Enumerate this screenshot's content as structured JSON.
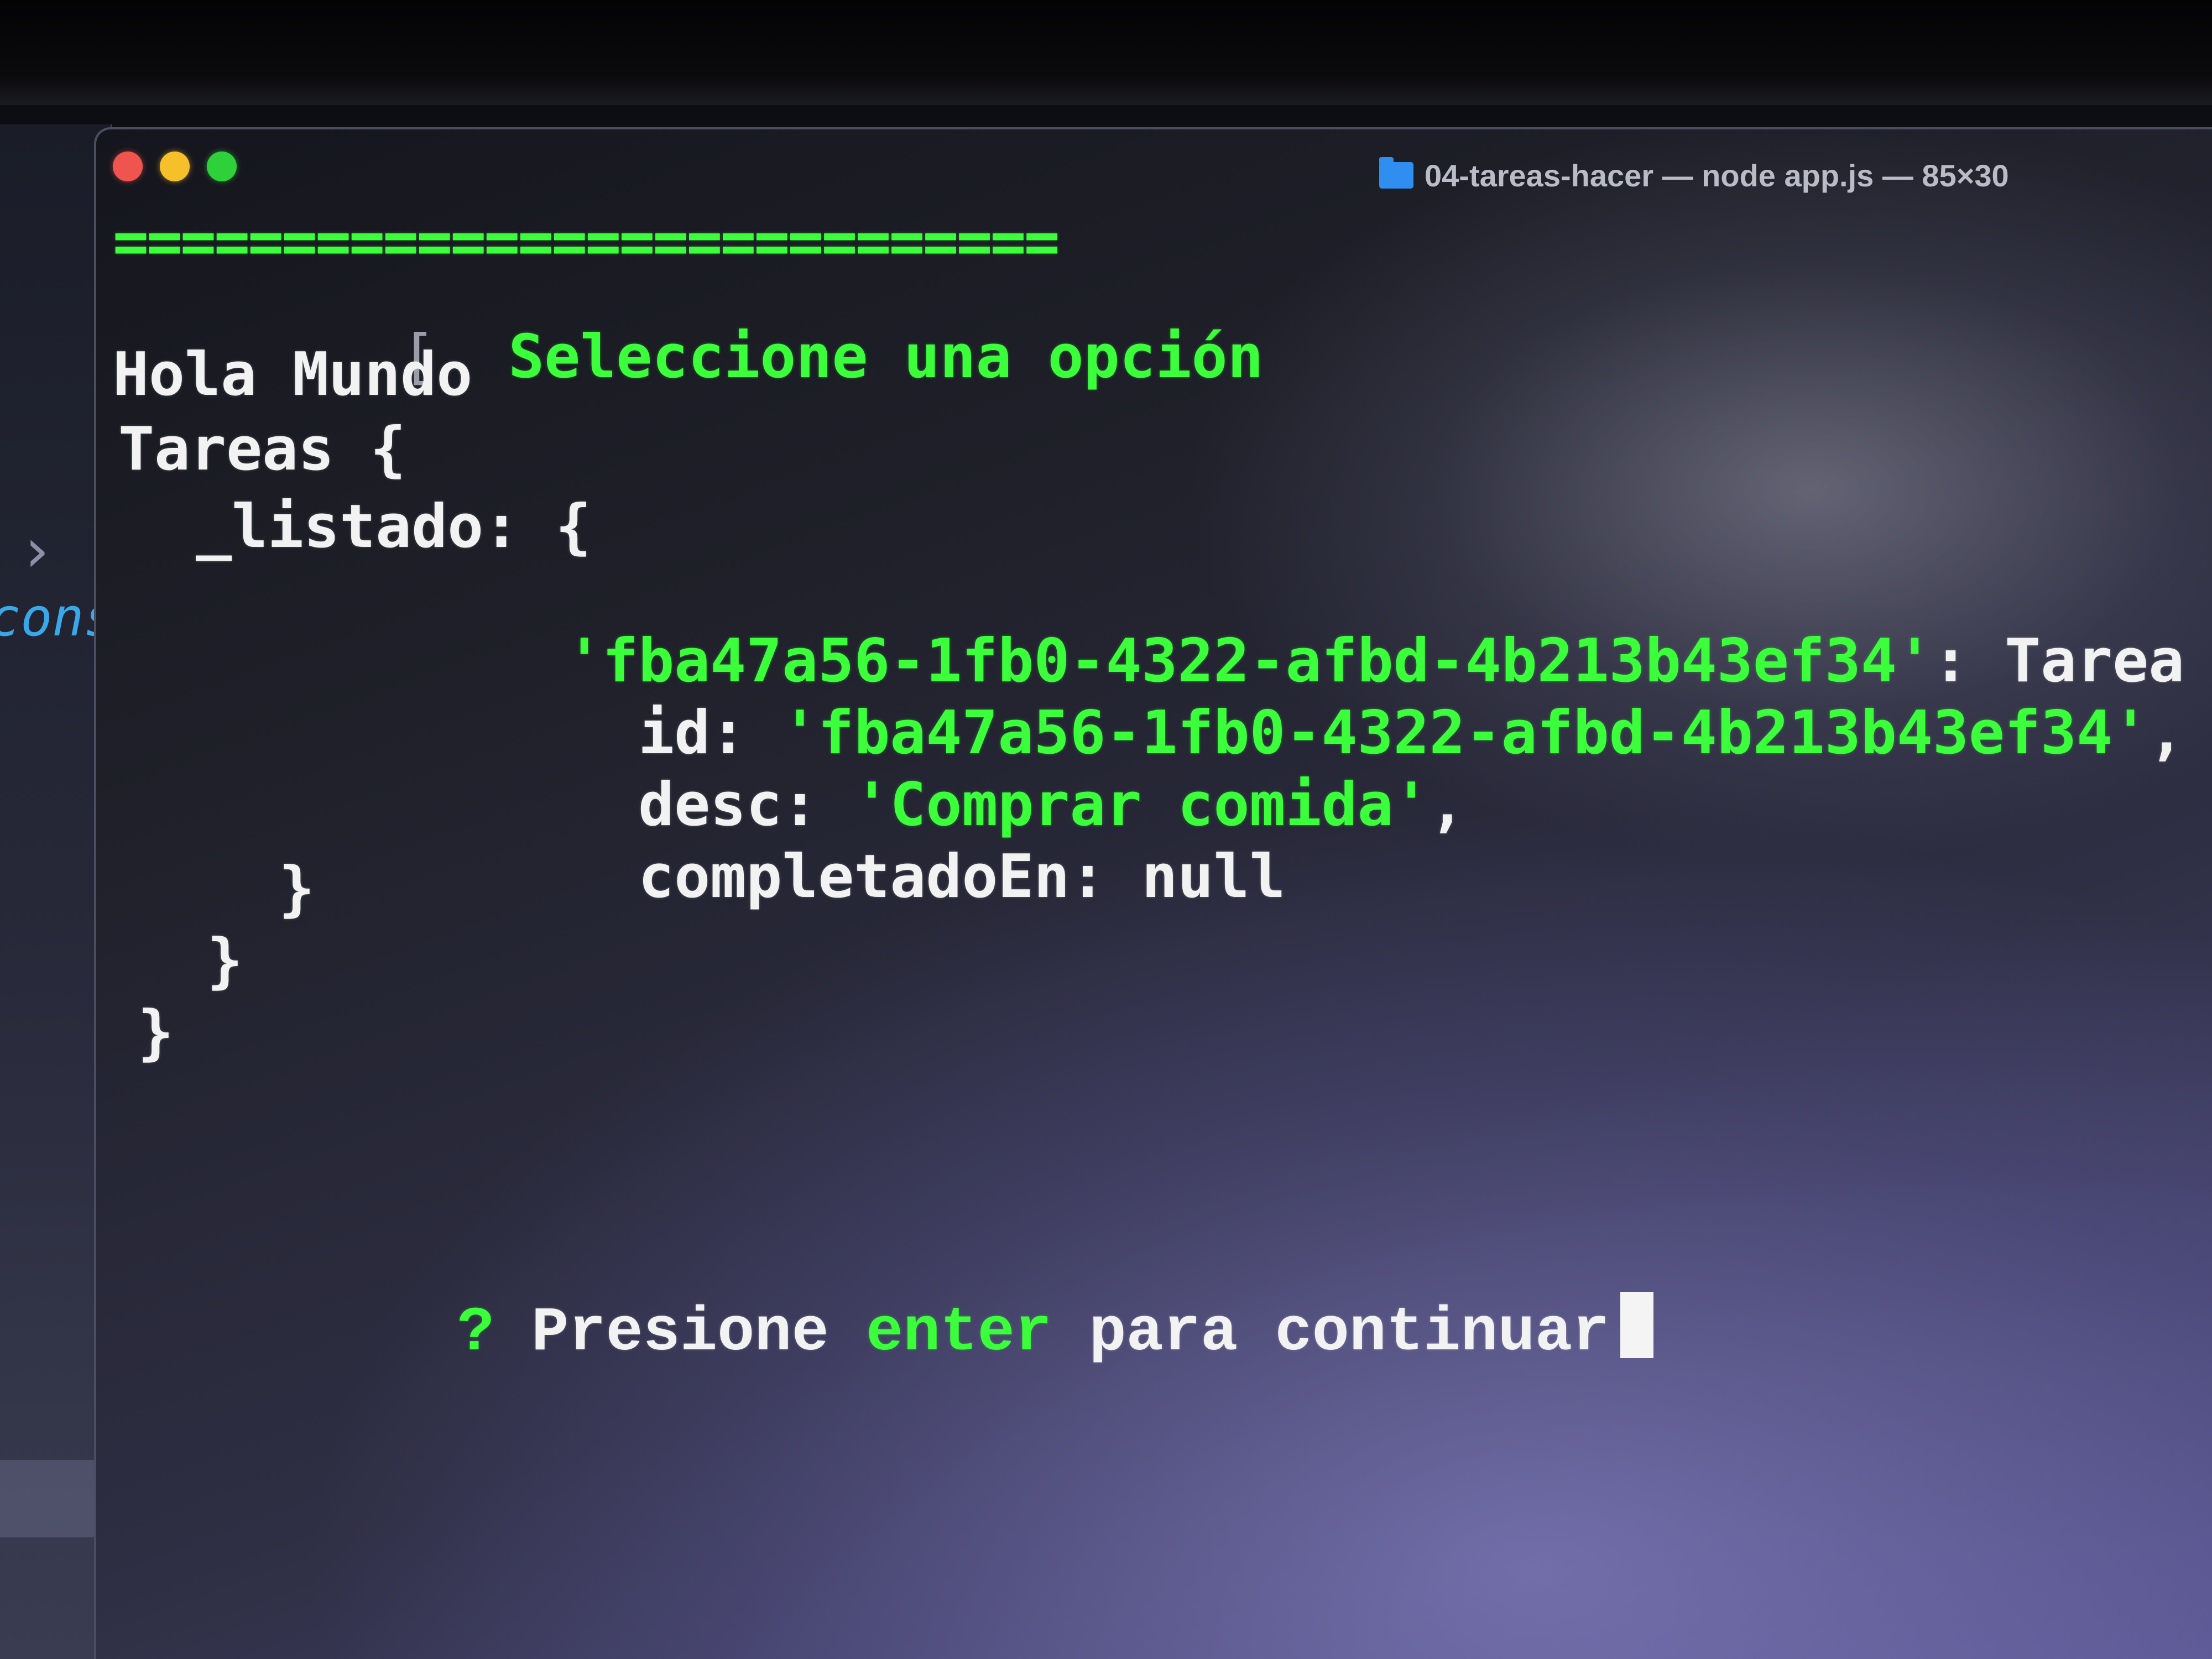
{
  "window": {
    "title": "04-tareas-hacer — node app.js — 85×30",
    "folder_icon": "folder-icon"
  },
  "colors": {
    "accent_green": "#3bff3b",
    "text_white": "#f2f2f2",
    "traffic_red": "#f0544f",
    "traffic_yellow": "#f5c02a",
    "traffic_green": "#2ed13a"
  },
  "editor": {
    "chevron": "›",
    "bracket": "[",
    "keyword": "cons"
  },
  "terminal": {
    "separator": "============================",
    "heading_bracket": "[",
    "heading": "Seleccione una opción",
    "hello": "Hola Mundo",
    "class_name": "Tareas {",
    "listado_key": "_listado: {",
    "task_key": "'fba47a56-1fb0-4322-afbd-4b213b43ef34'",
    "task_colon": ":",
    "task_class": "Tarea {",
    "id_label": "id:",
    "id_value": "'fba47a56-1fb0-4322-afbd-4b213b43ef34'",
    "id_comma": ",",
    "desc_label": "desc:",
    "desc_value": "'Comprar comida'",
    "desc_comma": ",",
    "completado_label": "completadoEn:",
    "completado_value": "null",
    "close_inner": "}",
    "close_listado": "}",
    "close_outer": "}",
    "prompt_mark": "?",
    "prompt_word1": "Presione",
    "prompt_word2": "enter",
    "prompt_word3": "para",
    "prompt_word4": "continuar"
  }
}
